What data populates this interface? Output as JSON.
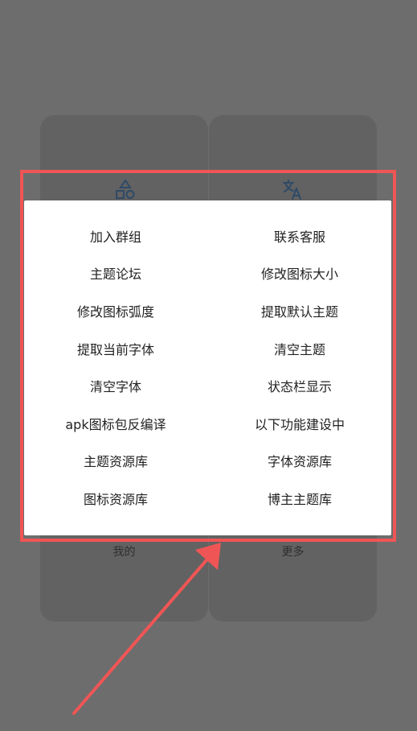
{
  "colors": {
    "overlay": "#6d6d6d",
    "card": "#626262",
    "popup": "#ffffff",
    "highlight": "#f05555",
    "accent": "#3d6b9a"
  },
  "cards": [
    {
      "label": "我的",
      "icon": "shapes-icon"
    },
    {
      "label": "更多",
      "icon": "translate-icon"
    }
  ],
  "menu": {
    "items": [
      {
        "left": "加入群组",
        "right": "联系客服"
      },
      {
        "left": "主题论坛",
        "right": "修改图标大小"
      },
      {
        "left": "修改图标弧度",
        "right": "提取默认主题"
      },
      {
        "left": "提取当前字体",
        "right": "清空主题"
      },
      {
        "left": "清空字体",
        "right": "状态栏显示"
      },
      {
        "left": "apk图标包反编译",
        "right": "以下功能建设中"
      },
      {
        "left": "主题资源库",
        "right": "字体资源库"
      },
      {
        "left": "图标资源库",
        "right": "博主主题库"
      }
    ]
  }
}
